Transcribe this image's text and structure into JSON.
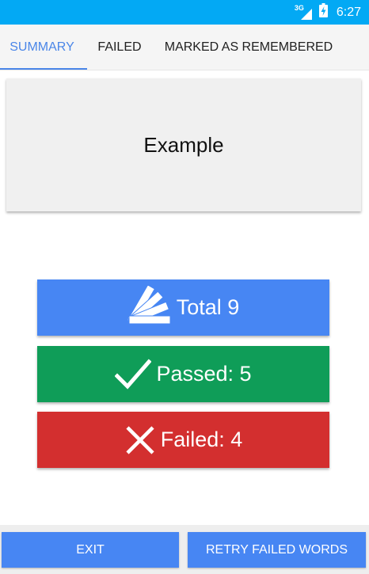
{
  "status_bar": {
    "network": "3G",
    "time": "6:27"
  },
  "tabs": [
    {
      "label": "SUMMARY",
      "active": true
    },
    {
      "label": "FAILED",
      "active": false
    },
    {
      "label": "MARKED AS REMEMBERED",
      "active": false
    }
  ],
  "word": "Example",
  "stats": {
    "total": {
      "label": "Total 9",
      "icon": "cards-fan-icon",
      "color": "#4786f3"
    },
    "passed": {
      "label": "Passed: 5",
      "icon": "check-icon",
      "color": "#0f9d58"
    },
    "failed": {
      "label": "Failed: 4",
      "icon": "close-icon",
      "color": "#d32f2f"
    }
  },
  "actions": {
    "exit": "EXIT",
    "retry": "RETRY FAILED WORDS"
  },
  "colors": {
    "status_bar": "#03a9f4",
    "accent": "#4a86e8"
  }
}
